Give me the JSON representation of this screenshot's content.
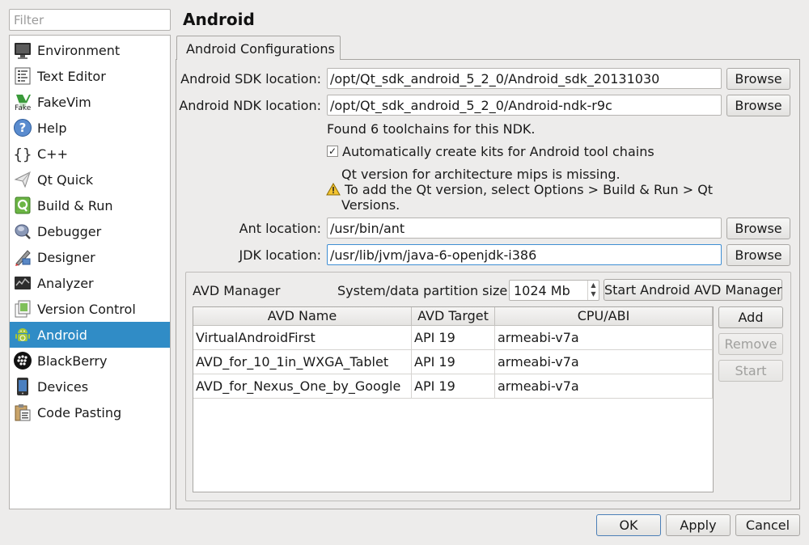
{
  "filter": {
    "placeholder": "Filter"
  },
  "sidebar": {
    "items": [
      {
        "label": "Environment",
        "icon": "monitor-icon"
      },
      {
        "label": "Text Editor",
        "icon": "text-editor-icon"
      },
      {
        "label": "FakeVim",
        "icon": "fakevim-icon",
        "icon_text": "Fake"
      },
      {
        "label": "Help",
        "icon": "help-icon"
      },
      {
        "label": "C++",
        "icon": "cpp-braces-icon"
      },
      {
        "label": "Qt Quick",
        "icon": "qt-quick-icon"
      },
      {
        "label": "Build & Run",
        "icon": "build-run-icon"
      },
      {
        "label": "Debugger",
        "icon": "debugger-icon"
      },
      {
        "label": "Designer",
        "icon": "designer-icon"
      },
      {
        "label": "Analyzer",
        "icon": "analyzer-icon"
      },
      {
        "label": "Version Control",
        "icon": "version-control-icon"
      },
      {
        "label": "Android",
        "icon": "android-icon",
        "selected": true
      },
      {
        "label": "BlackBerry",
        "icon": "blackberry-icon"
      },
      {
        "label": "Devices",
        "icon": "devices-icon"
      },
      {
        "label": "Code Pasting",
        "icon": "code-pasting-icon"
      }
    ],
    "selected_color": "#308cc6"
  },
  "page": {
    "title": "Android"
  },
  "tabs": [
    {
      "label": "Android Configurations",
      "active": true
    }
  ],
  "form": {
    "sdk_label": "Android SDK location:",
    "sdk_value": "/opt/Qt_sdk_android_5_2_0/Android_sdk_20131030",
    "ndk_label": "Android NDK location:",
    "ndk_value": "/opt/Qt_sdk_android_5_2_0/Android-ndk-r9c",
    "toolchains_found": "Found 6 toolchains for this NDK.",
    "auto_kits_label": "Automatically create kits for Android tool chains",
    "auto_kits_checked": true,
    "warning_line1": "Qt version for architecture mips is missing.",
    "warning_line2": "To add the Qt version, select Options > Build & Run > Qt",
    "warning_line3": "Versions.",
    "ant_label": "Ant location:",
    "ant_value": "/usr/bin/ant",
    "jdk_label": "JDK location:",
    "jdk_value": "/usr/lib/jvm/java-6-openjdk-i386",
    "browse_label": "Browse"
  },
  "avd": {
    "title": "AVD Manager",
    "partition_label": "System/data partition size:",
    "partition_value": "1024 Mb",
    "start_manager_label": "Start Android AVD Manager",
    "columns": [
      "AVD Name",
      "AVD Target",
      "CPU/ABI"
    ],
    "rows": [
      [
        "VirtualAndroidFirst",
        "API 19",
        "armeabi-v7a"
      ],
      [
        "AVD_for_10_1in_WXGA_Tablet",
        "API 19",
        "armeabi-v7a"
      ],
      [
        "AVD_for_Nexus_One_by_Google",
        "API 19",
        "armeabi-v7a"
      ]
    ],
    "add_label": "Add",
    "remove_label": "Remove",
    "start_label": "Start"
  },
  "footer": {
    "ok_label": "OK",
    "apply_label": "Apply",
    "cancel_label": "Cancel"
  }
}
